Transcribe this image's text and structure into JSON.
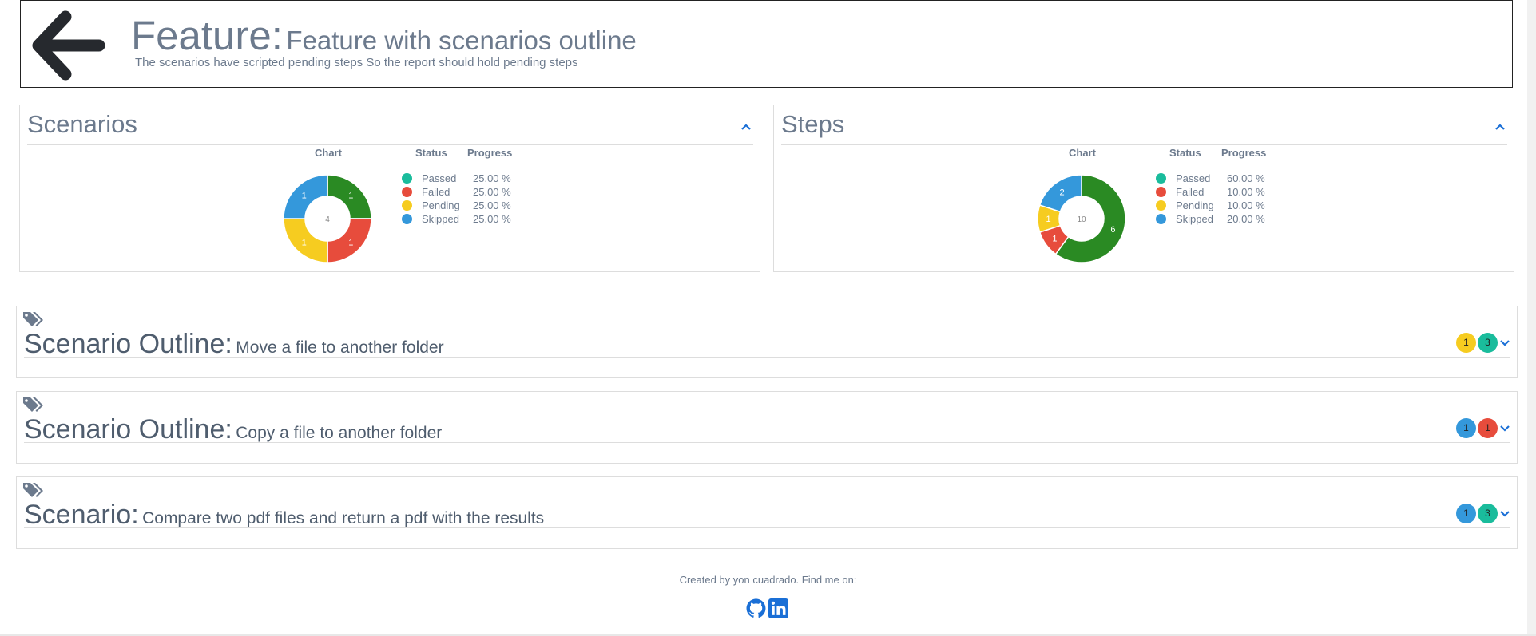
{
  "feature": {
    "keyword": "Feature:",
    "name": "Feature with scenarios outline",
    "description": "The scenarios have scripted pending steps So the report should hold pending steps"
  },
  "icons": {
    "back": "arrow-left-icon",
    "tag": "tags-icon",
    "toggle_up": "chevron-up-icon",
    "toggle_down": "chevron-down-icon",
    "github": "github-icon",
    "linkedin": "linkedin-icon"
  },
  "colors": {
    "passed": "#2a8a23",
    "failed": "#e74c3c",
    "pending": "#f6cc20",
    "skipped": "#3498db",
    "passed_icon": "#1abc9c",
    "link": "#1a6fd6"
  },
  "headers": {
    "chart": "Chart",
    "status": "Status",
    "progress": "Progress"
  },
  "scenarios_panel": {
    "title": "Scenarios",
    "chart_data": {
      "type": "pie",
      "total": "4",
      "slices": [
        {
          "label": "Passed",
          "value": 1,
          "color": "#2a8a23"
        },
        {
          "label": "Failed",
          "value": 1,
          "color": "#e74c3c"
        },
        {
          "label": "Pending",
          "value": 1,
          "color": "#f6cc20"
        },
        {
          "label": "Skipped",
          "value": 1,
          "color": "#3498db"
        }
      ]
    },
    "rows": [
      {
        "status": "Passed",
        "progress": "25.00 %"
      },
      {
        "status": "Failed",
        "progress": "25.00 %"
      },
      {
        "status": "Pending",
        "progress": "25.00 %"
      },
      {
        "status": "Skipped",
        "progress": "25.00 %"
      }
    ]
  },
  "steps_panel": {
    "title": "Steps",
    "chart_data": {
      "type": "pie",
      "total": "10",
      "slices": [
        {
          "label": "Passed",
          "value": 6,
          "color": "#2a8a23"
        },
        {
          "label": "Failed",
          "value": 1,
          "color": "#e74c3c"
        },
        {
          "label": "Pending",
          "value": 1,
          "color": "#f6cc20"
        },
        {
          "label": "Skipped",
          "value": 2,
          "color": "#3498db"
        }
      ]
    },
    "rows": [
      {
        "status": "Passed",
        "progress": "60.00 %"
      },
      {
        "status": "Failed",
        "progress": "10.00 %"
      },
      {
        "status": "Pending",
        "progress": "10.00 %"
      },
      {
        "status": "Skipped",
        "progress": "20.00 %"
      }
    ]
  },
  "scenarios": [
    {
      "keyword": "Scenario Outline:",
      "name": "Move a file to another folder",
      "badges": [
        {
          "count": "1",
          "color": "#f6cc20"
        },
        {
          "count": "3",
          "color": "#1abc9c"
        }
      ]
    },
    {
      "keyword": "Scenario Outline:",
      "name": "Copy a file to another folder",
      "badges": [
        {
          "count": "1",
          "color": "#3498db"
        },
        {
          "count": "1",
          "color": "#e74c3c"
        }
      ]
    },
    {
      "keyword": "Scenario:",
      "name": "Compare two pdf files and return a pdf with the results",
      "badges": [
        {
          "count": "1",
          "color": "#3498db"
        },
        {
          "count": "3",
          "color": "#1abc9c"
        }
      ]
    }
  ],
  "footer": {
    "text": "Created by yon cuadrado. Find me on:"
  }
}
